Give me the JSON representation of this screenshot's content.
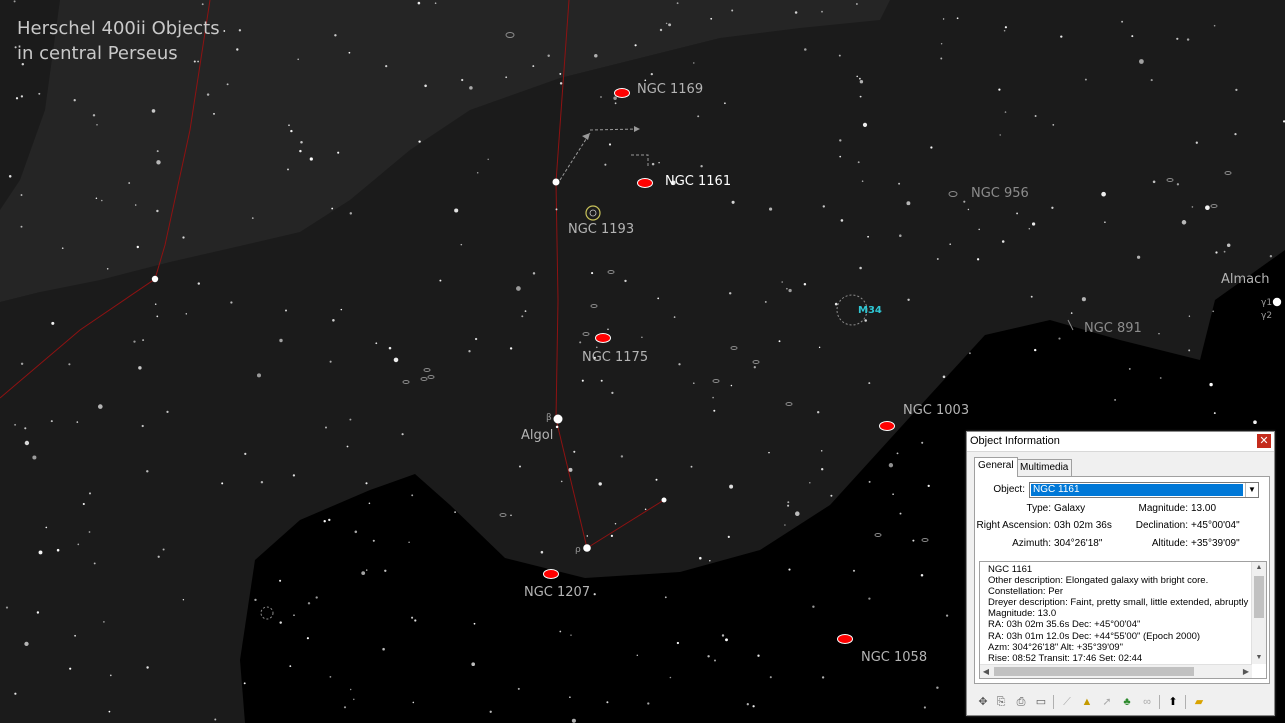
{
  "chart_title": "Herschel 400ii Objects\nin central Perseus",
  "objects": {
    "ngc1169": "NGC 1169",
    "ngc1161": "NGC 1161",
    "ngc1193": "NGC 1193",
    "ngc956": "NGC 956",
    "ngc1175": "NGC 1175",
    "m34": "M34",
    "almach": "Almach",
    "ngc891": "NGC 891",
    "algol": "Algol",
    "ngc1003": "NGC 1003",
    "ngc1207": "NGC 1207",
    "ngc1058": "NGC 1058"
  },
  "greek": {
    "beta": "β",
    "rho": "ρ",
    "gamma1": "γ1",
    "gamma2": "γ2"
  },
  "colors": {
    "background": "#000000",
    "milky_way": "#1b1b1b",
    "milky_way_dark": "#252525",
    "constellation_line": "#8e1212",
    "marker": "#ff0000"
  },
  "window": {
    "title": "Object Information",
    "close_icon": "close-icon",
    "tabs": [
      "General",
      "Multimedia"
    ],
    "object_label": "Object:",
    "object_value": "NGC 1161",
    "type_label": "Type:",
    "type_value": "Galaxy",
    "magnitude_label": "Magnitude:",
    "magnitude_value": "13.00",
    "ra_label": "Right Ascension:",
    "ra_value": "03h 02m 36s",
    "dec_label": "Declination:",
    "dec_value": "+45°00'04\"",
    "azimuth_label": "Azimuth:",
    "azimuth_value": "304°26'18\"",
    "altitude_label": "Altitude:",
    "altitude_value": "+35°39'09\"",
    "description": [
      "NGC 1161",
      "Other description: Elongated galaxy with bright core.",
      "Constellation:  Per",
      "Dreyer description: Faint, pretty small, little extended, abruptly brighter middle",
      "Magnitude: 13.0",
      "RA: 03h 02m 35.6s  Dec: +45°00'04\"",
      "RA: 03h 01m 12.0s  Dec: +44°55'00\"  (Epoch 2000)",
      "Azm: 304°26'18\"  Alt: +35°39'09\"",
      "Rise: 08:52  Transit: 17:46  Set: 02:44"
    ],
    "toolbar_icons": [
      "center-icon",
      "copy-icon",
      "print-icon",
      "book-icon",
      "telescope-icon",
      "chart-icon",
      "slew-icon",
      "tree-icon",
      "link-icon",
      "up-arrow-icon",
      "folder-icon"
    ]
  }
}
